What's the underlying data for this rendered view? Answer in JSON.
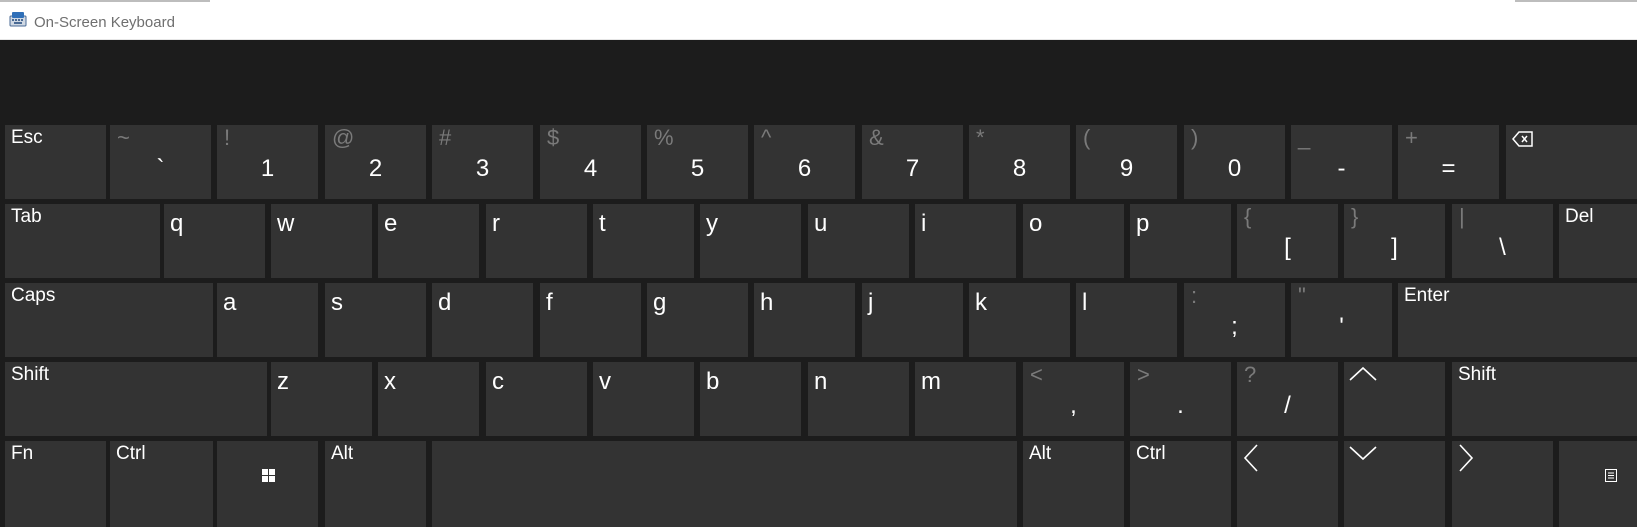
{
  "window": {
    "title": "On-Screen Keyboard",
    "app_icon": "keyboard-app-icon"
  },
  "rows": [
    [
      {
        "id": "esc",
        "label": "Esc"
      },
      {
        "id": "backtick",
        "shift": "~",
        "base": "`"
      },
      {
        "id": "1",
        "shift": "!",
        "base": "1"
      },
      {
        "id": "2",
        "shift": "@",
        "base": "2"
      },
      {
        "id": "3",
        "shift": "#",
        "base": "3"
      },
      {
        "id": "4",
        "shift": "$",
        "base": "4"
      },
      {
        "id": "5",
        "shift": "%",
        "base": "5"
      },
      {
        "id": "6",
        "shift": "^",
        "base": "6"
      },
      {
        "id": "7",
        "shift": "&",
        "base": "7"
      },
      {
        "id": "8",
        "shift": "*",
        "base": "8"
      },
      {
        "id": "9",
        "shift": "(",
        "base": "9"
      },
      {
        "id": "0",
        "shift": ")",
        "base": "0"
      },
      {
        "id": "minus",
        "shift": "_",
        "base": "-"
      },
      {
        "id": "equals",
        "shift": "+",
        "base": "="
      },
      {
        "id": "backspace",
        "icon": "backspace-icon"
      }
    ],
    [
      {
        "id": "tab",
        "label": "Tab"
      },
      {
        "id": "q",
        "main": "q"
      },
      {
        "id": "w",
        "main": "w"
      },
      {
        "id": "e",
        "main": "e"
      },
      {
        "id": "r",
        "main": "r"
      },
      {
        "id": "t",
        "main": "t"
      },
      {
        "id": "y",
        "main": "y"
      },
      {
        "id": "u",
        "main": "u"
      },
      {
        "id": "i",
        "main": "i"
      },
      {
        "id": "o",
        "main": "o"
      },
      {
        "id": "p",
        "main": "p"
      },
      {
        "id": "lbracket",
        "shift": "{",
        "base": "["
      },
      {
        "id": "rbracket",
        "shift": "}",
        "base": "]"
      },
      {
        "id": "backslash",
        "shift": "|",
        "base": "\\"
      },
      {
        "id": "del",
        "label": "Del"
      }
    ],
    [
      {
        "id": "caps",
        "label": "Caps"
      },
      {
        "id": "a",
        "main": "a"
      },
      {
        "id": "s",
        "main": "s"
      },
      {
        "id": "d",
        "main": "d"
      },
      {
        "id": "f",
        "main": "f"
      },
      {
        "id": "g",
        "main": "g"
      },
      {
        "id": "h",
        "main": "h"
      },
      {
        "id": "j",
        "main": "j"
      },
      {
        "id": "k",
        "main": "k"
      },
      {
        "id": "l",
        "main": "l"
      },
      {
        "id": "semicolon",
        "shift": ":",
        "base": ";"
      },
      {
        "id": "quote",
        "shift": "\"",
        "base": "'"
      },
      {
        "id": "enter",
        "label": "Enter"
      }
    ],
    [
      {
        "id": "shift-left",
        "label": "Shift"
      },
      {
        "id": "z",
        "main": "z"
      },
      {
        "id": "x",
        "main": "x"
      },
      {
        "id": "c",
        "main": "c"
      },
      {
        "id": "v",
        "main": "v"
      },
      {
        "id": "b",
        "main": "b"
      },
      {
        "id": "n",
        "main": "n"
      },
      {
        "id": "m",
        "main": "m"
      },
      {
        "id": "comma",
        "shift": "<",
        "base": ","
      },
      {
        "id": "period",
        "shift": ">",
        "base": "."
      },
      {
        "id": "slash",
        "shift": "?",
        "base": "/"
      },
      {
        "id": "arrow-up",
        "icon": "arrow-up-icon"
      },
      {
        "id": "shift-right",
        "label": "Shift"
      }
    ],
    [
      {
        "id": "fn",
        "label": "Fn"
      },
      {
        "id": "ctrl-left",
        "label": "Ctrl"
      },
      {
        "id": "win",
        "icon": "windows-logo-icon"
      },
      {
        "id": "alt-left",
        "label": "Alt"
      },
      {
        "id": "space"
      },
      {
        "id": "alt-right",
        "label": "Alt"
      },
      {
        "id": "ctrl-right",
        "label": "Ctrl"
      },
      {
        "id": "arrow-left",
        "icon": "arrow-left-icon"
      },
      {
        "id": "arrow-down",
        "icon": "arrow-down-icon"
      },
      {
        "id": "arrow-right",
        "icon": "arrow-right-icon"
      },
      {
        "id": "menu",
        "icon": "context-menu-icon"
      }
    ]
  ]
}
